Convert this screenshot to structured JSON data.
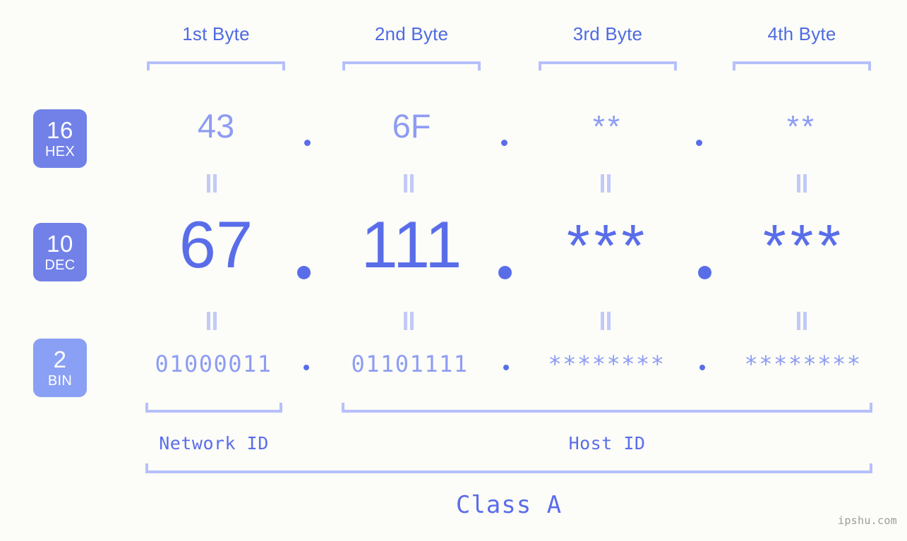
{
  "meta": {
    "background_color": "#fcfdf8",
    "accent_dark": "#5a6de9",
    "accent_light": "#8d9cf3",
    "bracket_color": "#b6c0fb",
    "badge_color": "#7181e8",
    "badge_color_light": "#8aa0f4"
  },
  "headers": {
    "bytes": [
      {
        "label": "1st Byte"
      },
      {
        "label": "2nd Byte"
      },
      {
        "label": "3rd Byte"
      },
      {
        "label": "4th Byte"
      }
    ]
  },
  "bases": [
    {
      "number": "16",
      "name": "HEX",
      "color": "#7181e8"
    },
    {
      "number": "10",
      "name": "DEC",
      "color": "#7181e8"
    },
    {
      "number": "2",
      "name": "BIN",
      "color": "#8aa0f4"
    }
  ],
  "rows": {
    "hex": {
      "base_number": "16",
      "base_name": "HEX",
      "values": [
        "43",
        "6F",
        "**",
        "**"
      ],
      "separator": "."
    },
    "dec": {
      "base_number": "10",
      "base_name": "DEC",
      "values": [
        "67",
        "111",
        "***",
        "***"
      ],
      "separator": "."
    },
    "bin": {
      "base_number": "2",
      "base_name": "BIN",
      "values": [
        "01000011",
        "01101111",
        "********",
        "********"
      ],
      "separator": "."
    }
  },
  "equality_mark": "=",
  "footer": {
    "network_id_label": "Network ID",
    "host_id_label": "Host ID",
    "class_label": "Class A",
    "watermark": "ipshu.com"
  }
}
